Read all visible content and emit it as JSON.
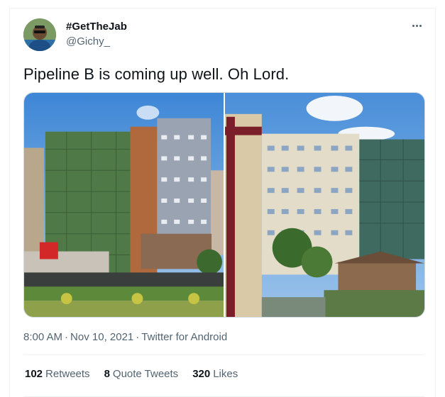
{
  "tweet": {
    "display_name": "#GetTheJab",
    "handle": "@Gichy_",
    "text": "Pipeline B is coming up well. Oh Lord.",
    "time": "8:00 AM",
    "date": "Nov 10, 2021",
    "source": "Twitter for Android",
    "more_icon": "ellipsis-icon",
    "media": [
      {
        "name": "construction-site-photo-1"
      },
      {
        "name": "construction-site-photo-2"
      }
    ]
  },
  "stats": {
    "retweets_count": "102",
    "retweets_label": "Retweets",
    "quotes_count": "8",
    "quotes_label": "Quote Tweets",
    "likes_count": "320",
    "likes_label": "Likes"
  },
  "colors": {
    "text_primary": "#0f1419",
    "text_secondary": "#536471",
    "border": "#eff3f4"
  }
}
